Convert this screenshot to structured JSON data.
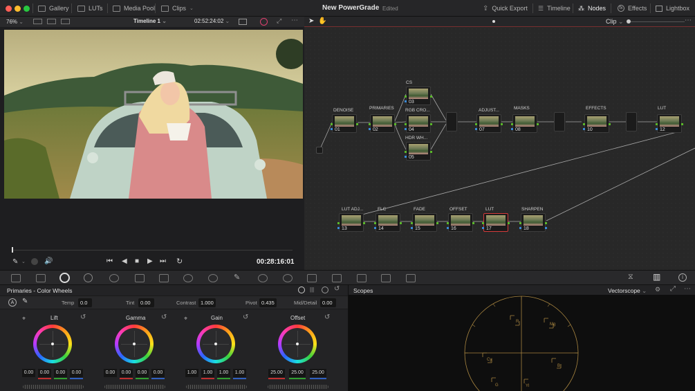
{
  "titlebar": {
    "items": [
      "Gallery",
      "LUTs",
      "Media Pool",
      "Clips"
    ],
    "title": "New PowerGrade",
    "status": "Edited",
    "right_items": [
      "Quick Export",
      "Timeline",
      "Nodes",
      "Effects",
      "Lightbox"
    ]
  },
  "viewer": {
    "zoom": "76%",
    "timeline": "Timeline 1",
    "timecode_top": "02:52:24:02",
    "timecode": "00:28:16:01"
  },
  "nodebar": {
    "mode": "Clip"
  },
  "nodes": {
    "labels": [
      "DENOISE",
      "PRIMARIES",
      "CS",
      "RGB CRO...",
      "HDR WH...",
      "ADJUST...",
      "MASKS",
      "EFFECTS",
      "LUT",
      "LUT ADJ...",
      "FLC",
      "FADE",
      "OFFSET",
      "LUT",
      "SHARPEN"
    ],
    "numbers": [
      "01",
      "02",
      "03",
      "04",
      "05",
      "07",
      "08",
      "10",
      "12",
      "13",
      "14",
      "15",
      "16",
      "17",
      "18"
    ]
  },
  "wheels": {
    "title": "Primaries - Color Wheels",
    "params": {
      "temp_label": "Temp",
      "temp": "0.0",
      "tint_label": "Tint",
      "tint": "0.00",
      "contrast_label": "Contrast",
      "contrast": "1.000",
      "pivot_label": "Pivot",
      "pivot": "0.435",
      "middetail_label": "Mid/Detail",
      "middetail": "0.00"
    },
    "lift": {
      "label": "Lift",
      "values": [
        "0.00",
        "0.00",
        "0.00",
        "0.00"
      ]
    },
    "gamma": {
      "label": "Gamma",
      "values": [
        "0.00",
        "0.00",
        "0.00",
        "0.00"
      ]
    },
    "gain": {
      "label": "Gain",
      "values": [
        "1.00",
        "1.00",
        "1.00",
        "1.00"
      ]
    },
    "offset": {
      "label": "Offset",
      "values": [
        "25.00",
        "25.00",
        "25.00"
      ]
    }
  },
  "scopes": {
    "title": "Scopes",
    "mode": "Vectorscope",
    "targets": [
      "R",
      "Mg",
      "B",
      "Cy",
      "G",
      "Yl"
    ]
  },
  "colors": {
    "accent": "#d53a3a",
    "node_pin": "#5ab82a",
    "node_pin_blue": "#3a8ad6",
    "scope_graticule": "#b08a3c"
  }
}
